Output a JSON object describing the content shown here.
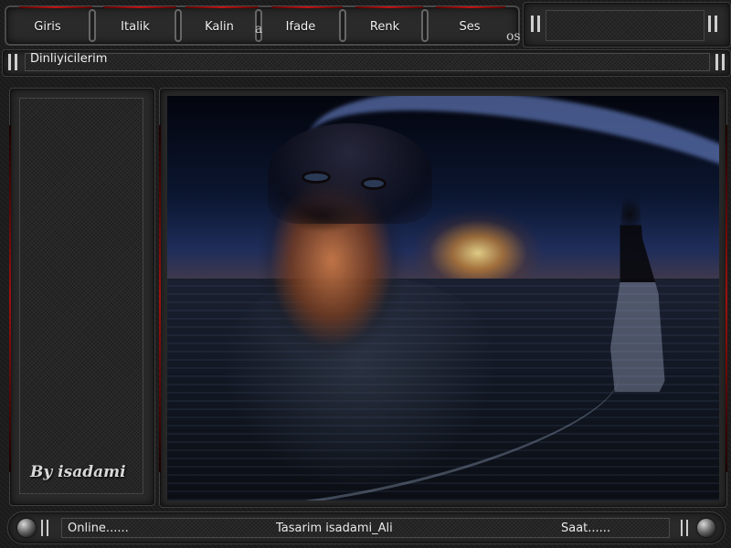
{
  "menu": {
    "items": [
      "Giris",
      "Italik",
      "Kalin",
      "Ifade",
      "Renk",
      "Ses"
    ],
    "decorations": [
      "a",
      "os"
    ]
  },
  "listeners": {
    "label": "Dinliyicilerim"
  },
  "sidebar": {
    "signature": "By isadami"
  },
  "status": {
    "online": "Online......",
    "credit": "Tasarim  isadami_Ali",
    "clock": "Saat......"
  },
  "icons": [
    "grip-icon",
    "knob-icon"
  ],
  "colors": {
    "accent_red": "#c01010",
    "panel": "#2a2a2a",
    "background": "#1b1b1b"
  }
}
